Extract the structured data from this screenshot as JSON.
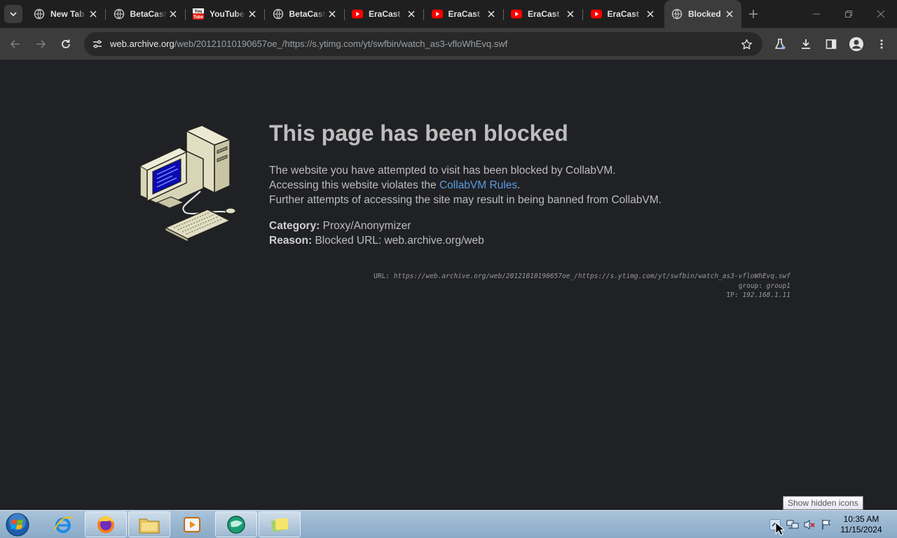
{
  "browser": {
    "tabs": [
      {
        "title": "New Tab",
        "icon": "globe-icon"
      },
      {
        "title": "BetaCast",
        "icon": "globe-icon"
      },
      {
        "title": "YouTube",
        "icon": "youtube-classic-icon"
      },
      {
        "title": "BetaCast",
        "icon": "globe-icon"
      },
      {
        "title": "EraCast",
        "icon": "youtube-play-icon"
      },
      {
        "title": "EraCast",
        "icon": "youtube-play-icon"
      },
      {
        "title": "EraCast",
        "icon": "youtube-play-icon"
      },
      {
        "title": "EraCast",
        "icon": "youtube-play-icon"
      },
      {
        "title": "Blocked",
        "icon": "globe-icon",
        "active": true
      }
    ],
    "address": {
      "host": "web.archive.org",
      "path": "/web/20121010190657oe_/https://s.ytimg.com/yt/swfbin/watch_as3-vfloWhEvq.swf"
    }
  },
  "page": {
    "heading": "This page has been blocked",
    "line1": "The website you have attempted to visit has been blocked by CollabVM.",
    "line2_pre": "Accessing this website violates the ",
    "line2_link": "CollabVM Rules",
    "line2_post": ".",
    "line3": "Further attempts of accessing the site may result in being banned from CollabVM.",
    "category_label": "Category:",
    "category_value": " Proxy/Anonymizer",
    "reason_label": "Reason:",
    "reason_value": " Blocked URL: web.archive.org/web",
    "debug_url_label": "URL: ",
    "debug_url": "https://web.archive.org/web/20121010190657oe_/https://s.ytimg.com/yt/swfbin/watch_as3-vfloWhEvq.swf",
    "debug_group_label": "group: ",
    "debug_group": "group1",
    "debug_ip_label": "IP: ",
    "debug_ip": "192.168.1.11"
  },
  "taskbar": {
    "tooltip": "Show hidden icons",
    "time": "10:35 AM",
    "date": "11/15/2024"
  },
  "colors": {
    "link": "#5a9be3",
    "youtube_red": "#ff0000"
  }
}
